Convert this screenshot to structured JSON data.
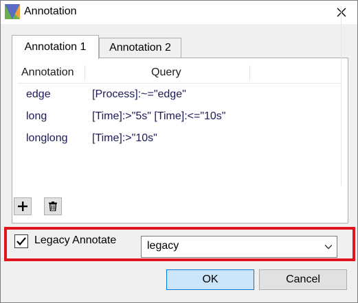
{
  "window": {
    "title": "Annotation"
  },
  "tabs": [
    {
      "label": "Annotation 1",
      "active": true
    },
    {
      "label": "Annotation 2",
      "active": false
    }
  ],
  "grid": {
    "columns": [
      "Annotation",
      "Query"
    ],
    "rows": [
      {
        "annotation": "edge",
        "query": "[Process]:~=\"edge\""
      },
      {
        "annotation": "long",
        "query": "[Time]:>\"5s\" [Time]:<=\"10s\""
      },
      {
        "annotation": "longlong",
        "query": "[Time]:>\"10s\""
      }
    ]
  },
  "toolbar": {
    "add_icon": "plus-icon",
    "delete_icon": "trash-icon"
  },
  "legacy": {
    "checkbox_label": "Legacy Annotate",
    "checked": true,
    "select_value": "legacy"
  },
  "buttons": {
    "ok_label": "OK",
    "cancel_label": "Cancel"
  },
  "colors": {
    "highlight": "#e0141e",
    "ok_fill": "#cce4f7",
    "ok_border": "#0078d7",
    "cell_text": "#1a1a59"
  }
}
